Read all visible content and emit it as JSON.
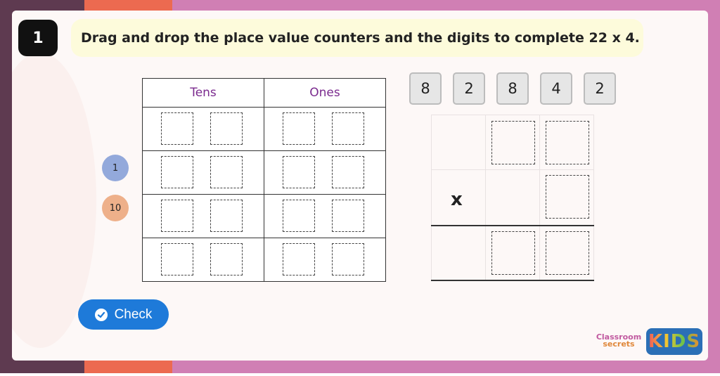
{
  "question": {
    "number": "1",
    "text": "Drag and drop the place value counters and the digits to complete 22 x 4."
  },
  "place_value_table": {
    "headers": [
      "Tens",
      "Ones"
    ],
    "rows": 4,
    "slots_per_cell": 2
  },
  "counters": [
    {
      "label": "1",
      "color": "#93a9db"
    },
    {
      "label": "10",
      "color": "#eeb08a"
    }
  ],
  "digit_cards": [
    "8",
    "2",
    "8",
    "4",
    "2"
  ],
  "calculation": {
    "operator": "x"
  },
  "check_button": {
    "label": "Check",
    "color": "#1e7ad9"
  },
  "logo": {
    "line1": "Classroom",
    "line2": "secrets",
    "kids": "KIDS"
  },
  "colors": {
    "header_text": "#7a2a8e",
    "question_bg": "#fdfbdb"
  }
}
